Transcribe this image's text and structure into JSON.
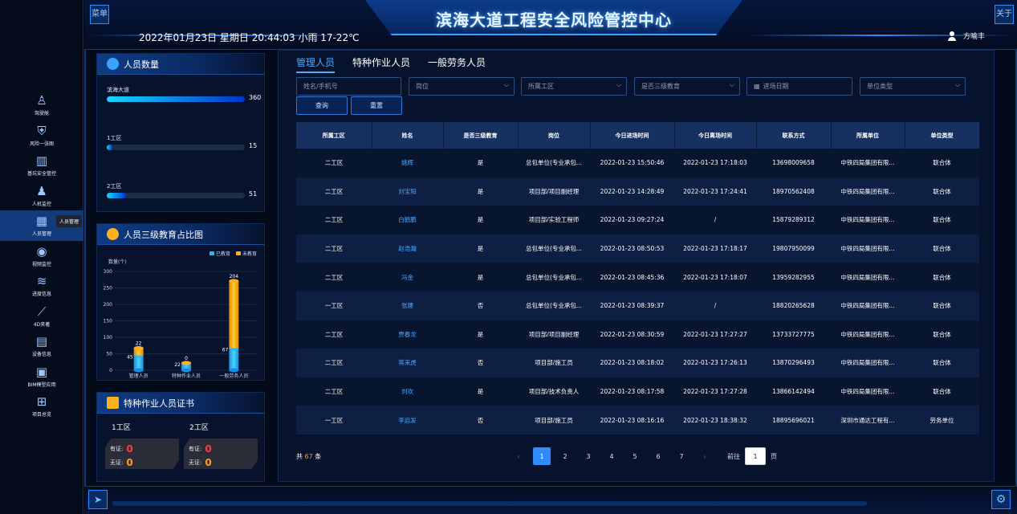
{
  "header": {
    "title": "滨海大道工程安全风险管控中心",
    "datetime": "2022年01月23日 星期日 20:44:03",
    "weather": "小雨 17-22℃",
    "user": "方喻丰",
    "left_badge": "菜单",
    "right_badge": "关于"
  },
  "sidebar": {
    "items": [
      {
        "label": "驾驶舱",
        "icon": "person-icon"
      },
      {
        "label": "风险一张图",
        "icon": "shield-icon"
      },
      {
        "label": "基坑安全管控",
        "icon": "pit-icon"
      },
      {
        "label": "人机监控",
        "icon": "worker-icon"
      },
      {
        "label": "人员管理",
        "icon": "calendar-icon",
        "active": true
      },
      {
        "label": "视频监控",
        "icon": "camera-icon"
      },
      {
        "label": "进度信息",
        "icon": "layers-icon"
      },
      {
        "label": "4D夹著",
        "icon": "chart-icon"
      },
      {
        "label": "设备信息",
        "icon": "device-icon"
      },
      {
        "label": "BIM模型应用",
        "icon": "cube-icon"
      },
      {
        "label": "项目总览",
        "icon": "grid-icon"
      }
    ],
    "tooltip": "人员管理"
  },
  "people_count": {
    "title": "人员数量",
    "rows": [
      {
        "label": "滨海大道",
        "value": 360,
        "fraction": 1.0
      },
      {
        "label": "1工区",
        "value": 15,
        "fraction": 0.04
      },
      {
        "label": "2工区",
        "value": 51,
        "fraction": 0.14
      }
    ]
  },
  "edu_chart": {
    "title": "人员三级教育占比图"
  },
  "chart_data": {
    "type": "bar",
    "stacked": true,
    "ylabel": "数量(个)",
    "ylim": [
      0,
      300
    ],
    "yticks": [
      0,
      50,
      100,
      150,
      200,
      250,
      300
    ],
    "categories": [
      "管理人员",
      "特种作业人员",
      "一般劳务人员"
    ],
    "series": [
      {
        "name": "已教育",
        "color": "#2ab5ff",
        "values": [
          45,
          22,
          67
        ]
      },
      {
        "name": "未教育",
        "color": "#ffb020",
        "values": [
          22,
          0,
          204
        ]
      }
    ],
    "legend_position": "top-right",
    "grid": true
  },
  "cert": {
    "title": "特种作业人员证书",
    "cols": [
      {
        "name": "1工区",
        "has_label": "有证:",
        "has": "0",
        "none_label": "无证:",
        "none": "0"
      },
      {
        "name": "2工区",
        "has_label": "有证:",
        "has": "0",
        "none_label": "无证:",
        "none": "0"
      }
    ]
  },
  "main": {
    "tabs": [
      "管理人员",
      "特种作业人员",
      "一般劳务人员"
    ],
    "filters": {
      "name_placeholder": "姓名/手机号",
      "post": "岗位",
      "area": "所属工区",
      "edu": "是否三级教育",
      "date": "进场日期",
      "unit_type": "单位类型"
    },
    "query_btn": "查询",
    "reset_btn": "重置",
    "columns": [
      "所属工区",
      "姓名",
      "是否三级教育",
      "岗位",
      "今日进场时间",
      "今日离场时间",
      "联系方式",
      "所属单位",
      "单位类型"
    ],
    "rows": [
      [
        "二工区",
        "姚辉",
        "是",
        "总包单位(专业承包...",
        "2022-01-23 15:50:46",
        "2022-01-23 17:18:03",
        "13698009658",
        "中铁四局集团有限...",
        "联合体"
      ],
      [
        "二工区",
        "刘宝阳",
        "是",
        "项目部/项目副经理",
        "2022-01-23 14:28:49",
        "2022-01-23 17:24:41",
        "18970562408",
        "中铁四局集团有限...",
        "联合体"
      ],
      [
        "二工区",
        "白鹤鹏",
        "是",
        "项目部/实验工程师",
        "2022-01-23 09:27:24",
        "/",
        "15879289312",
        "中铁四局集团有限...",
        "联合体"
      ],
      [
        "二工区",
        "赵浩瀚",
        "是",
        "总包单位(专业承包...",
        "2022-01-23 08:50:53",
        "2022-01-23 17:18:17",
        "19807950099",
        "中铁四局集团有限...",
        "联合体"
      ],
      [
        "二工区",
        "冯金",
        "是",
        "总包单位(专业承包...",
        "2022-01-23 08:45:36",
        "2022-01-23 17:18:07",
        "13959282955",
        "中铁四局集团有限...",
        "联合体"
      ],
      [
        "一工区",
        "张建",
        "否",
        "总包单位(专业承包...",
        "2022-01-23 08:39:37",
        "/",
        "18820265628",
        "中铁四局集团有限...",
        "联合体"
      ],
      [
        "二工区",
        "贾春龙",
        "是",
        "项目部/项目副经理",
        "2022-01-23 08:30:59",
        "2022-01-23 17:27:27",
        "13733727775",
        "中铁四局集团有限...",
        "联合体"
      ],
      [
        "二工区",
        "蒋来虎",
        "否",
        "项目部/施工员",
        "2022-01-23 08:18:02",
        "2022-01-23 17:26:13",
        "13870296493",
        "中铁四局集团有限...",
        "联合体"
      ],
      [
        "二工区",
        "刘欢",
        "是",
        "项目部/技术负责人",
        "2022-01-23 08:17:58",
        "2022-01-23 17:27:28",
        "13866142494",
        "中铁四局集团有限...",
        "联合体"
      ],
      [
        "一工区",
        "李启发",
        "否",
        "项目部/施工员",
        "2022-01-23 08:16:16",
        "2022-01-23 18:38:32",
        "18895696021",
        "深圳市通达工程有...",
        "劳务单位"
      ]
    ],
    "total_prefix": "共",
    "total": "67",
    "total_suffix": "条",
    "pages": [
      "1",
      "2",
      "3",
      "4",
      "5",
      "6",
      "7"
    ],
    "goto_prefix": "前往",
    "goto_value": "1",
    "goto_suffix": "页"
  }
}
